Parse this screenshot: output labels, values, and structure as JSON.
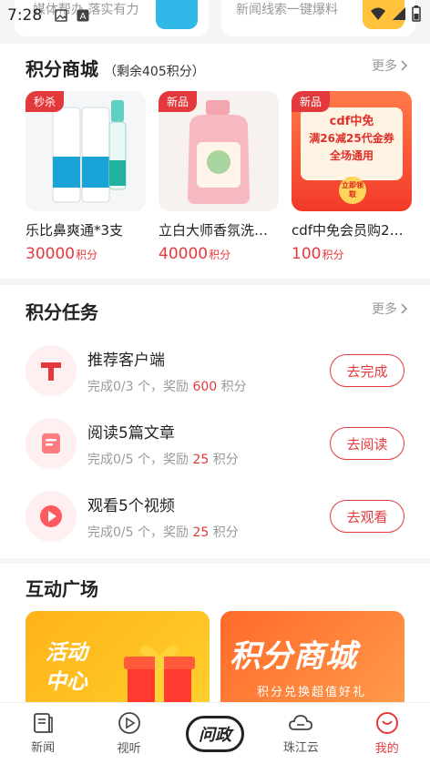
{
  "status": {
    "time": "7:28"
  },
  "top_cards": [
    {
      "text": "媒体帮办 落实有力"
    },
    {
      "text": "新闻线索一键爆料"
    }
  ],
  "shop": {
    "title": "积分商城",
    "subtitle": "（剩余405积分）",
    "more": "更多",
    "products": [
      {
        "tag": "秒杀",
        "name": "乐比鼻爽通*3支",
        "price": "30000",
        "unit": "积分"
      },
      {
        "tag": "新品",
        "name": "立白大师香氛洗衣…",
        "price": "40000",
        "unit": "积分"
      },
      {
        "tag": "新品",
        "name": "cdf中免会员购25…",
        "price": "100",
        "unit": "积分",
        "image_text": {
          "title": "cdf中免",
          "line2": "满26减25代金券",
          "line3": "全场通用",
          "badge": "立即领取"
        }
      }
    ]
  },
  "tasks": {
    "title": "积分任务",
    "more": "更多",
    "items": [
      {
        "title": "推荐客户端",
        "progress": "完成0/3 个，奖励",
        "reward": "600",
        "unit": "积分",
        "button": "去完成"
      },
      {
        "title": "阅读5篇文章",
        "progress": "完成0/5 个，奖励",
        "reward": "25",
        "unit": "积分",
        "button": "去阅读"
      },
      {
        "title": "观看5个视频",
        "progress": "完成0/5 个，奖励",
        "reward": "25",
        "unit": "积分",
        "button": "去观看"
      }
    ]
  },
  "plaza": {
    "title": "互动广场",
    "cards": [
      {
        "title_line1": "活动",
        "title_line2": "中心"
      },
      {
        "title": "积分商城",
        "subtitle": "积分兑换超值好礼"
      }
    ]
  },
  "tabbar": {
    "items": [
      {
        "label": "新闻"
      },
      {
        "label": "视听"
      },
      {
        "label": "问政"
      },
      {
        "label": "珠江云"
      },
      {
        "label": "我的"
      }
    ]
  },
  "colors": {
    "accent": "#e4393c"
  }
}
